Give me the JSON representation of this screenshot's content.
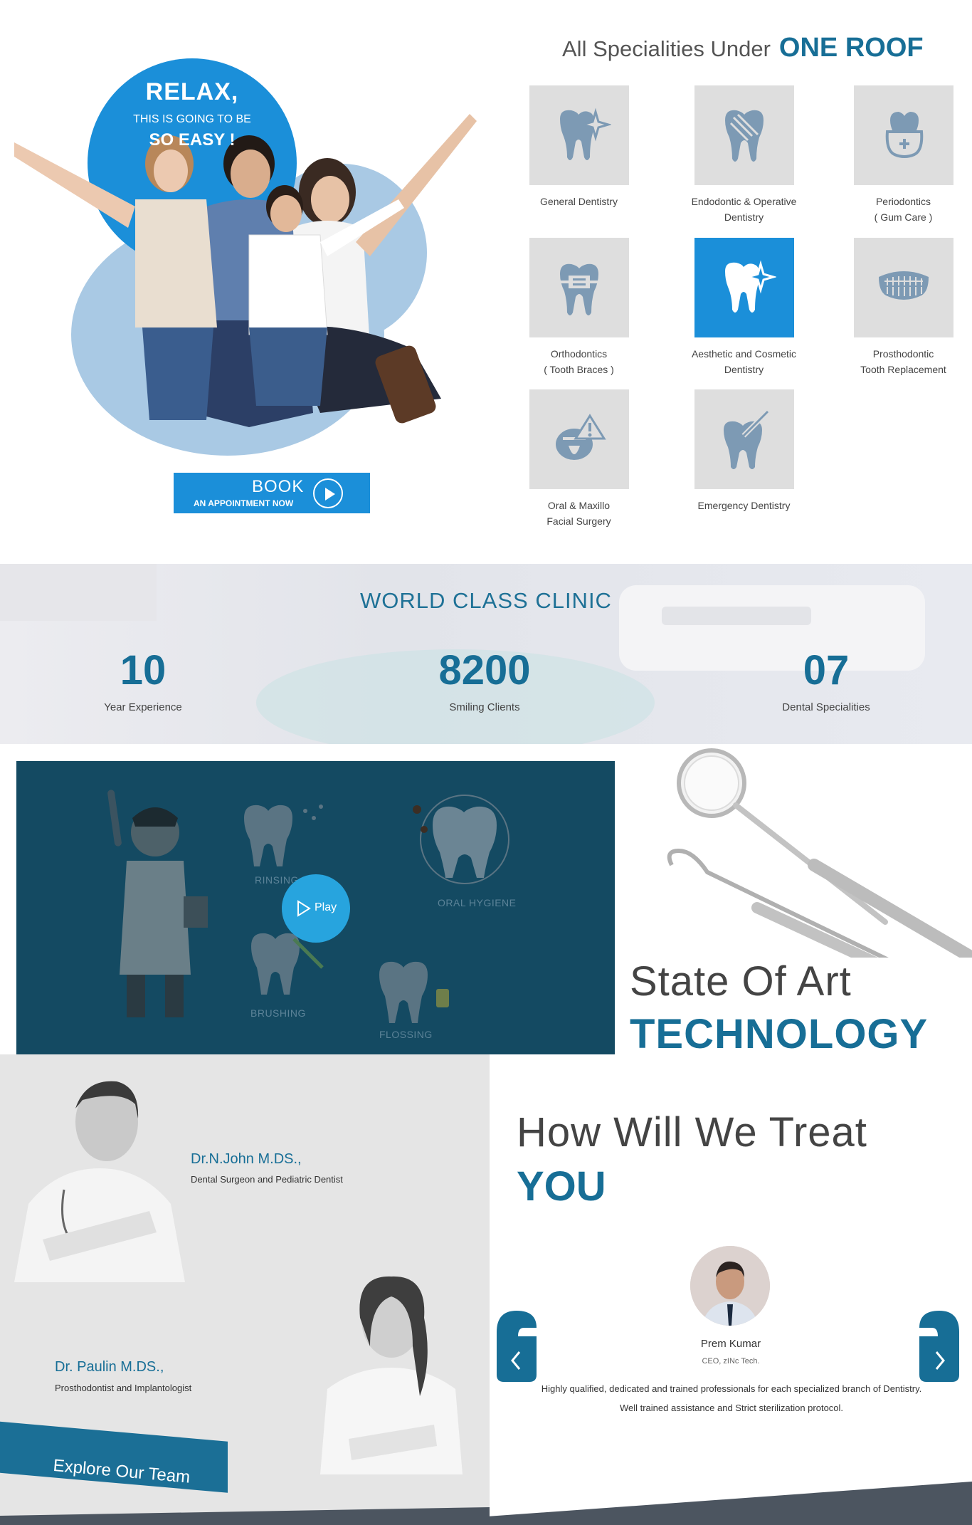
{
  "hero": {
    "relax": "RELAX,",
    "going": "THIS IS GOING TO BE",
    "easy": "SO EASY !",
    "book": "BOOK",
    "book_sub": "AN APPOINTMENT NOW"
  },
  "specialities": {
    "heading_light": "All Specialities Under",
    "heading_bold": "ONE ROOF",
    "items": [
      {
        "line1": "General Dentistry",
        "line2": "",
        "icon": "tooth-sparkle-icon"
      },
      {
        "line1": "Endodontic & Operative",
        "line2": "Dentistry",
        "icon": "tooth-striped-icon"
      },
      {
        "line1": "Periodontics",
        "line2": "( Gum Care )",
        "icon": "tooth-gum-icon"
      },
      {
        "line1": "Orthodontics",
        "line2": "( Tooth Braces )",
        "icon": "tooth-braces-icon"
      },
      {
        "line1": "Aesthetic and Cosmetic",
        "line2": "Dentistry",
        "icon": "tooth-sparkle-icon"
      },
      {
        "line1": "Prosthodontic",
        "line2": "Tooth Replacement",
        "icon": "denture-icon"
      },
      {
        "line1": "Oral & Maxillo",
        "line2": "Facial Surgery",
        "icon": "mouth-warning-icon"
      },
      {
        "line1": "Emergency Dentistry",
        "line2": "",
        "icon": "tooth-syringe-icon"
      }
    ]
  },
  "stats": {
    "title": "WORLD CLASS CLINIC",
    "items": [
      {
        "number": "10",
        "label": "Year Experience"
      },
      {
        "number": "8200",
        "label": "Smiling Clients"
      },
      {
        "number": "07",
        "label": "Dental Specialities"
      }
    ]
  },
  "video": {
    "labels": {
      "rinsing": "RINSING",
      "oral": "ORAL HYGIENE",
      "brushing": "BRUSHING",
      "flossing": "FLOSSING"
    },
    "play": "Play"
  },
  "tech": {
    "line1": "State Of Art",
    "line2": "TECHNOLOGY"
  },
  "team": {
    "doctors": [
      {
        "name": "Dr.N.John M.DS.,",
        "title": "Dental Surgeon and Pediatric Dentist"
      },
      {
        "name": "Dr. Paulin M.DS.,",
        "title": "Prosthodontist and Implantologist"
      }
    ],
    "explore": "Explore Our Team"
  },
  "treat": {
    "heading_light": "How Will We Treat",
    "heading_bold": "YOU",
    "testimonial": {
      "name": "Prem Kumar",
      "role": "CEO, zINc Tech.",
      "quote_line1": "Highly qualified, dedicated and trained professionals for each specialized branch of Dentistry.",
      "quote_line2": "Well trained assistance and Strict sterilization protocol."
    }
  },
  "colors": {
    "accent_blue": "#1b8fd9",
    "brand_dark_blue": "#176e96",
    "video_bg": "#144a62",
    "tile_grey": "#dedede",
    "icon_grey": "#7d9ab4"
  }
}
